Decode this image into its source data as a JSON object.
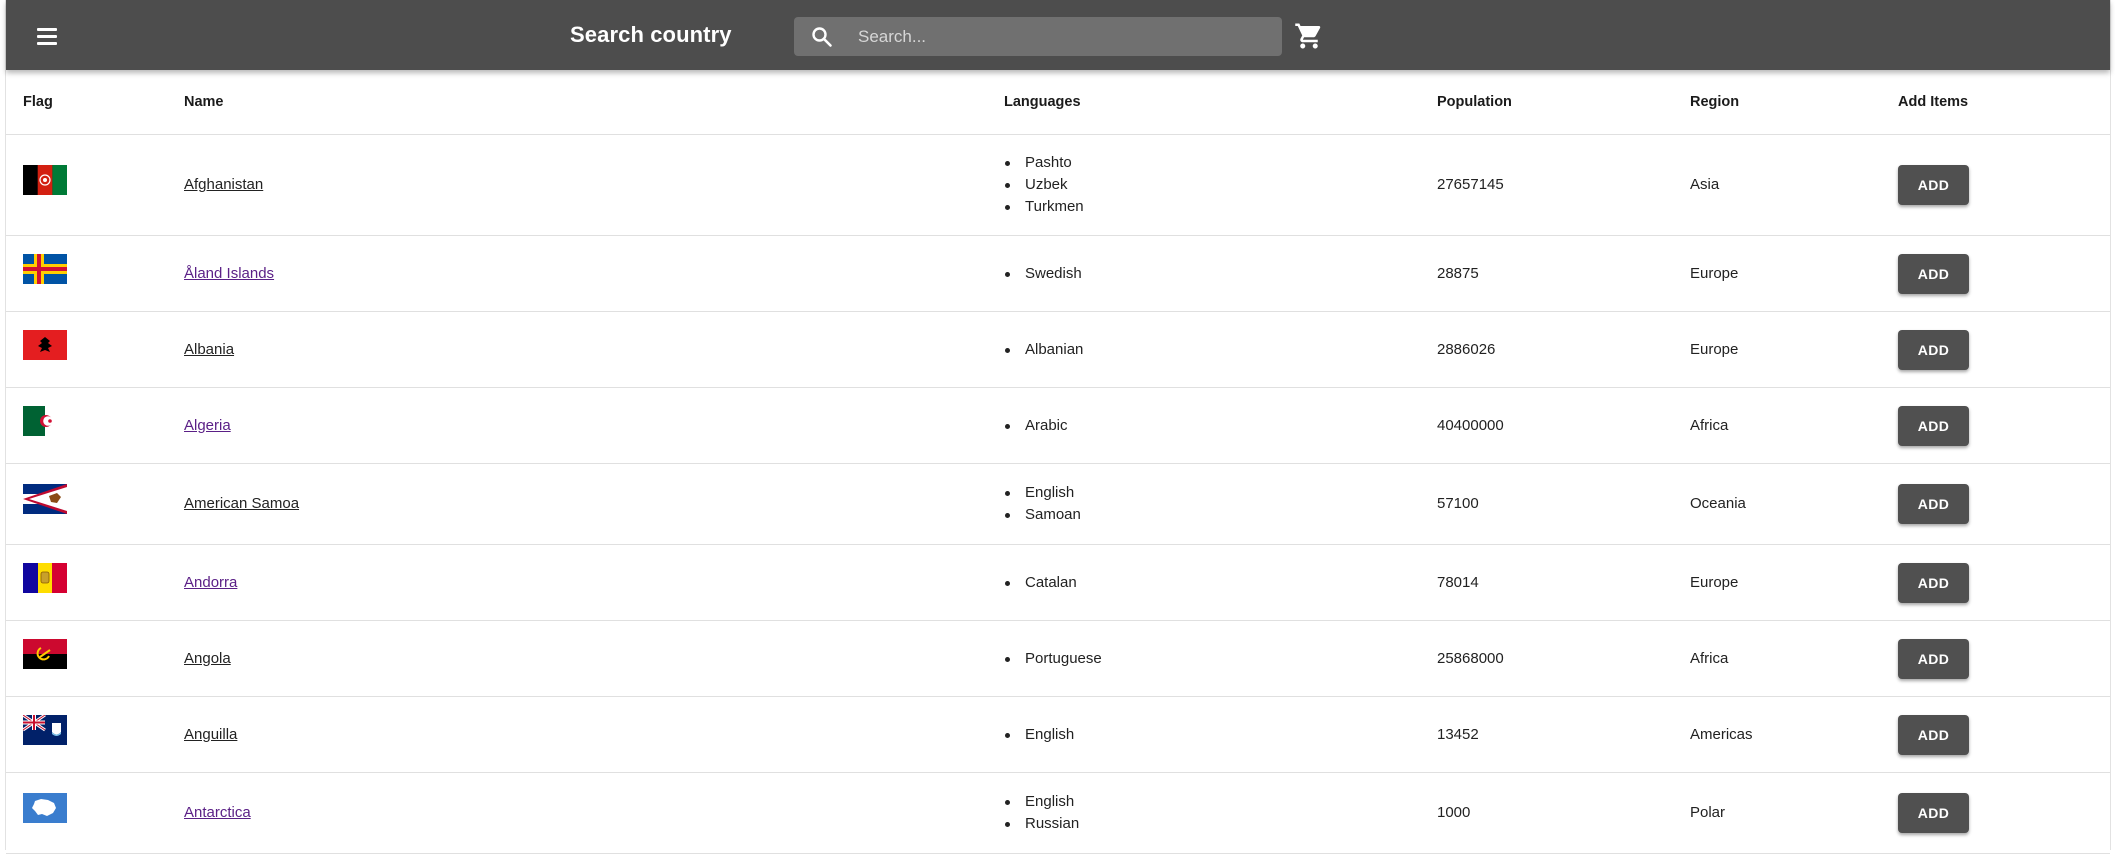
{
  "toolbar": {
    "title": "Search country",
    "search_placeholder": "Search...",
    "search_value": "",
    "menu_icon": "menu-icon",
    "search_icon": "search-icon",
    "cart_icon": "cart-icon",
    "background": "#4d4d4d"
  },
  "table": {
    "headers": [
      "Flag",
      "Name",
      "Languages",
      "Population",
      "Region",
      "Add Items"
    ],
    "add_label": "ADD",
    "rows": [
      {
        "flag": "flag-afghanistan",
        "name": "Afghanistan",
        "visited": false,
        "languages": [
          "Pashto",
          "Uzbek",
          "Turkmen"
        ],
        "population": "27657145",
        "region": "Asia"
      },
      {
        "flag": "flag-aland-islands",
        "name": "Åland Islands",
        "visited": true,
        "languages": [
          "Swedish"
        ],
        "population": "28875",
        "region": "Europe"
      },
      {
        "flag": "flag-albania",
        "name": "Albania",
        "visited": false,
        "languages": [
          "Albanian"
        ],
        "population": "2886026",
        "region": "Europe"
      },
      {
        "flag": "flag-algeria",
        "name": "Algeria",
        "visited": true,
        "languages": [
          "Arabic"
        ],
        "population": "40400000",
        "region": "Africa"
      },
      {
        "flag": "flag-american-samoa",
        "name": "American Samoa",
        "visited": false,
        "languages": [
          "English",
          "Samoan"
        ],
        "population": "57100",
        "region": "Oceania"
      },
      {
        "flag": "flag-andorra",
        "name": "Andorra",
        "visited": true,
        "languages": [
          "Catalan"
        ],
        "population": "78014",
        "region": "Europe"
      },
      {
        "flag": "flag-angola",
        "name": "Angola",
        "visited": false,
        "languages": [
          "Portuguese"
        ],
        "population": "25868000",
        "region": "Africa"
      },
      {
        "flag": "flag-anguilla",
        "name": "Anguilla",
        "visited": false,
        "languages": [
          "English"
        ],
        "population": "13452",
        "region": "Americas"
      },
      {
        "flag": "flag-antarctica",
        "name": "Antarctica",
        "visited": true,
        "languages": [
          "English",
          "Russian"
        ],
        "population": "1000",
        "region": "Polar"
      }
    ]
  }
}
